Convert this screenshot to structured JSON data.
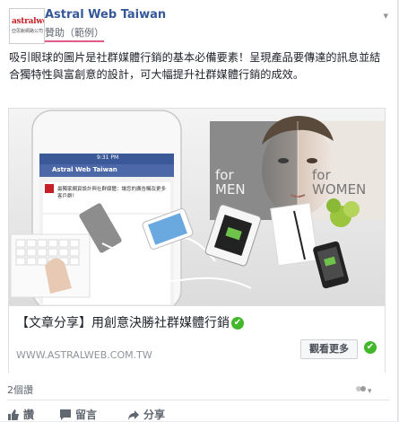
{
  "post": {
    "page_name": "Astral Web Taiwan",
    "sponsored": "贊助（範例）",
    "logo_text": "astralweb",
    "logo_sub": "亞思銳網路公司",
    "body": "吸引眼球的圖片是社群媒體行銷的基本必備要素！呈現產品要傳達的訊息並結合獨特性與富創意的設計，可大幅提升社群媒體行銷的成效。"
  },
  "ad": {
    "phone_time": "9:31 PM",
    "phone_page": "Astral Web Taiwan",
    "phone_text": "最獨家網頁設計與社群媒體：讓您的廣告觸及更多客戶群！",
    "men_label": "for MEN",
    "women_label": "for WOMEN",
    "title": "【文章分享】用創意決勝社群媒體行銷",
    "url": "WWW.ASTRALWEB.COM.TW",
    "cta": "觀看更多"
  },
  "footer": {
    "likes": "2個讚",
    "like_label": "讚",
    "comment_label": "留言",
    "share_label": "分享"
  },
  "colors": {
    "link": "#365899",
    "check": "#42b72a",
    "highlight": "#e05a8a"
  }
}
